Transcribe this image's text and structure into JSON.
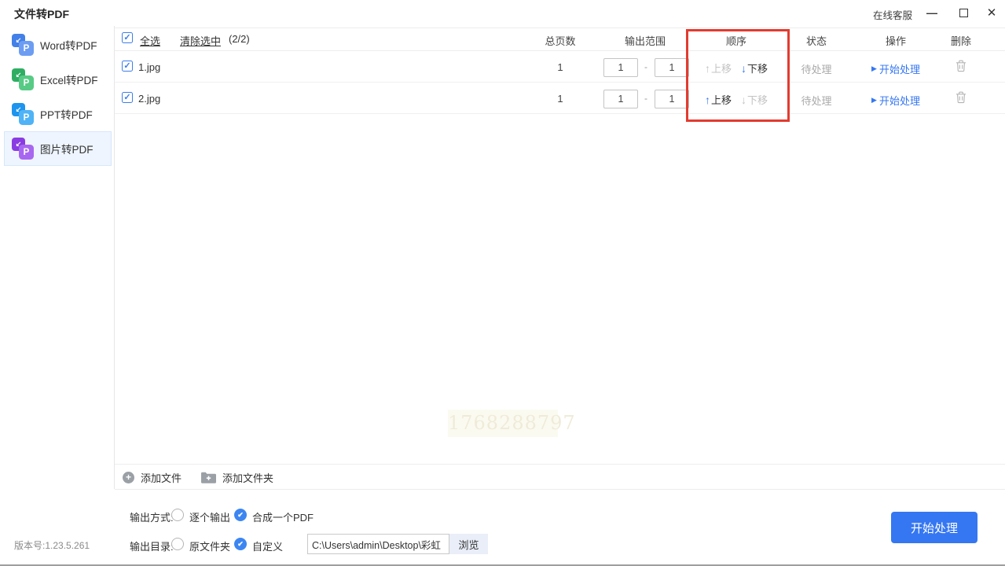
{
  "titlebar": {
    "title": "文件转PDF",
    "online_service": "在线客服"
  },
  "icons": {
    "arrow_up": "↑",
    "arrow_down": "↓",
    "play": "▶",
    "plus": "+",
    "corner_arrow": "↙",
    "dash": "-",
    "minimize": "—",
    "close": "✕",
    "check": "✓",
    "radio_check": "✔"
  },
  "sidebar": {
    "items": [
      {
        "label": "Word转PDF",
        "letter": "P",
        "back": "#4380e8",
        "front": "#6d9df2",
        "selected": false
      },
      {
        "label": "Excel转PDF",
        "letter": "P",
        "back": "#2fae63",
        "front": "#57cb85",
        "selected": false
      },
      {
        "label": "PPT转PDF",
        "letter": "P",
        "back": "#1d94ee",
        "front": "#4fb3f6",
        "selected": false
      },
      {
        "label": "图片转PDF",
        "letter": "P",
        "back": "#8a3ce2",
        "front": "#a867f0",
        "selected": true
      }
    ],
    "version": "版本号:1.23.5.261"
  },
  "list": {
    "select_all": "全选",
    "clear_selected": "清除选中",
    "selected_count": "(2/2)",
    "columns": [
      "总页数",
      "输出范围",
      "顺序",
      "状态",
      "操作",
      "删除"
    ],
    "move_up": "上移",
    "move_down": "下移",
    "rows": [
      {
        "filename": "1.jpg",
        "pages": "1",
        "range_from": "1",
        "range_to": "1",
        "up_enabled": false,
        "down_enabled": true,
        "status": "待处理",
        "action": "开始处理"
      },
      {
        "filename": "2.jpg",
        "pages": "1",
        "range_from": "1",
        "range_to": "1",
        "up_enabled": true,
        "down_enabled": false,
        "status": "待处理",
        "action": "开始处理"
      }
    ],
    "add_file": "添加文件",
    "add_folder": "添加文件夹"
  },
  "watermark": "1768288797",
  "options": {
    "output_mode_label": "输出方式:",
    "mode_options": [
      {
        "label": "逐个输出",
        "selected": false
      },
      {
        "label": "合成一个PDF",
        "selected": true
      }
    ],
    "output_dir_label": "输出目录:",
    "dir_options": [
      {
        "label": "原文件夹",
        "selected": false
      },
      {
        "label": "自定义",
        "selected": true
      }
    ],
    "path_value": "C:\\Users\\admin\\Desktop\\彩虹",
    "browse_label": "浏览",
    "start_button": "开始处理"
  },
  "highlight": {
    "color": "#e23b30",
    "highlighted_column": "顺序"
  },
  "colors": {
    "accent_blue": "#3577f2",
    "checkbox_blue": "#3d7ee9",
    "status_gray": "#a9a9a9",
    "disabled_gray": "#c3c3c3",
    "highlight_red": "#e23b30",
    "selected_item_bg": "#eef5fe",
    "watermark_bg": "#fbfaf1"
  }
}
